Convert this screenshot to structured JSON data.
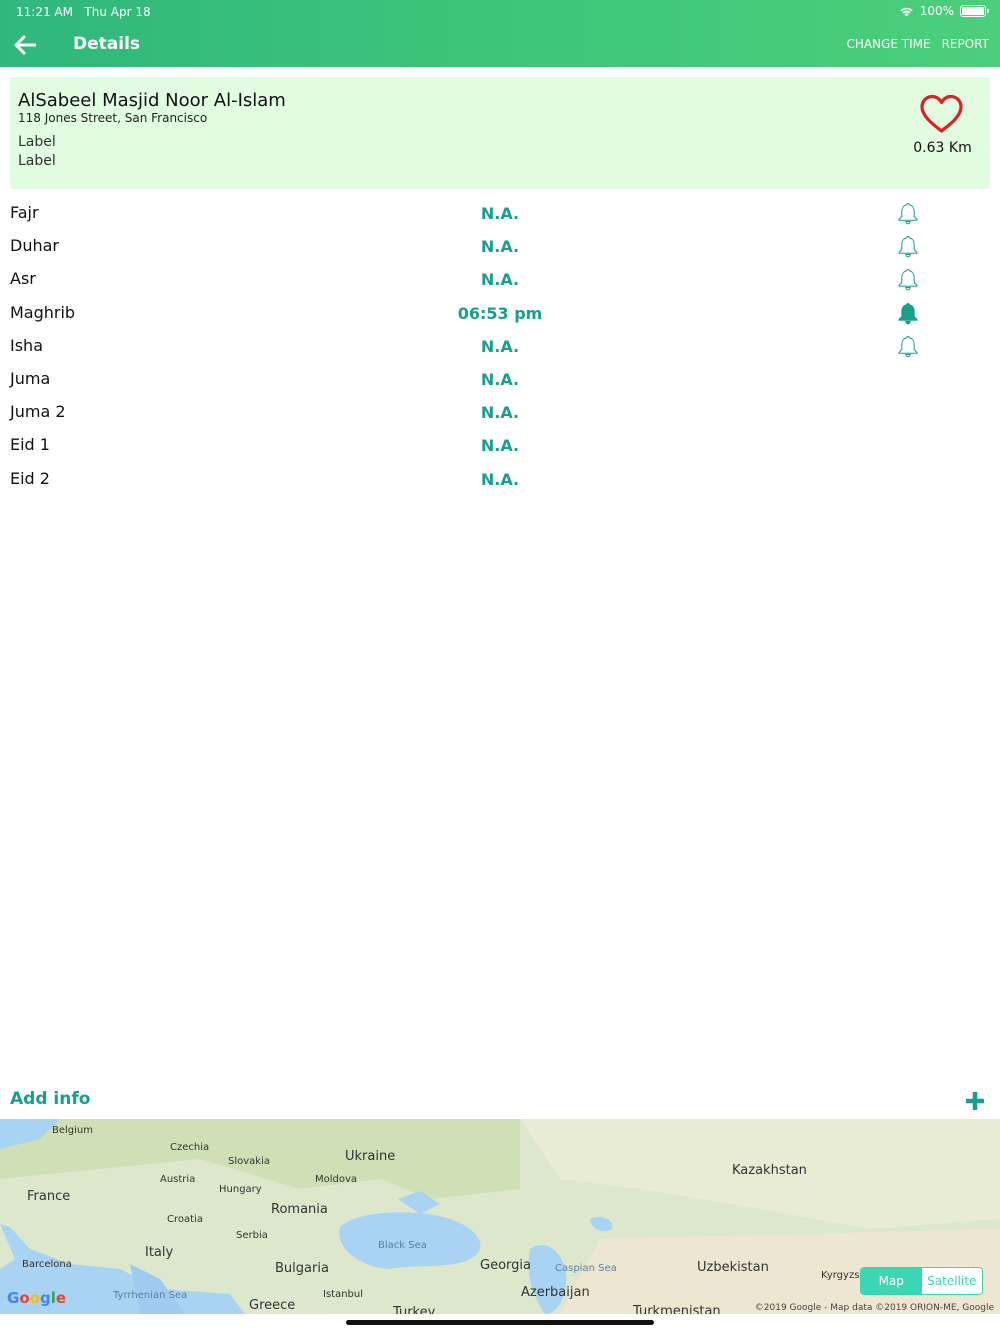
{
  "status_bar": {
    "time": "11:21 AM",
    "date": "Thu Apr 18",
    "battery": "100%"
  },
  "nav": {
    "title": "Details",
    "change_time": "CHANGE TIME",
    "report": "REPORT"
  },
  "masjid": {
    "name": "AlSabeel Masjid Noor Al-Islam",
    "address": "118 Jones Street, San Francisco",
    "label1": "Label",
    "label2": "Label",
    "distance": "0.63 Km"
  },
  "prayers": [
    {
      "name": "Fajr",
      "time": "N.A.",
      "bell": "outline"
    },
    {
      "name": "Duhar",
      "time": "N.A.",
      "bell": "outline"
    },
    {
      "name": "Asr",
      "time": "N.A.",
      "bell": "outline"
    },
    {
      "name": "Maghrib",
      "time": "06:53 pm",
      "bell": "filled"
    },
    {
      "name": "Isha",
      "time": "N.A.",
      "bell": "outline"
    },
    {
      "name": "Juma",
      "time": "N.A.",
      "bell": "none"
    },
    {
      "name": "Juma 2",
      "time": "N.A.",
      "bell": "none"
    },
    {
      "name": "Eid 1",
      "time": "N.A.",
      "bell": "none"
    },
    {
      "name": "Eid 2",
      "time": "N.A.",
      "bell": "none"
    }
  ],
  "add_info": {
    "label": "Add info"
  },
  "map": {
    "labels": [
      "Belgium",
      "Czechia",
      "Slovakia",
      "Ukraine",
      "Kazakhstan",
      "Austria",
      "Moldova",
      "France",
      "Hungary",
      "Romania",
      "Croatia",
      "Serbia",
      "Italy",
      "Black Sea",
      "Barcelona",
      "Bulgaria",
      "Georgia",
      "Caspian Sea",
      "Uzbekistan",
      "Kyrgyzs",
      "Tyrrhenian Sea",
      "Greece",
      "Istanbul",
      "Azerbaijan",
      "Turkey",
      "Turkmenistan"
    ],
    "toggle_map": "Map",
    "toggle_satellite": "Satellite",
    "copyright": "©2019 Google - Map data ©2019 ORION-ME, Google",
    "google": "Google"
  },
  "colors": {
    "accent": "#17a08d",
    "header_start": "#2fb77d",
    "header_end": "#4bcf7a",
    "card_bg": "#e1fce0",
    "heart": "#e02020"
  }
}
